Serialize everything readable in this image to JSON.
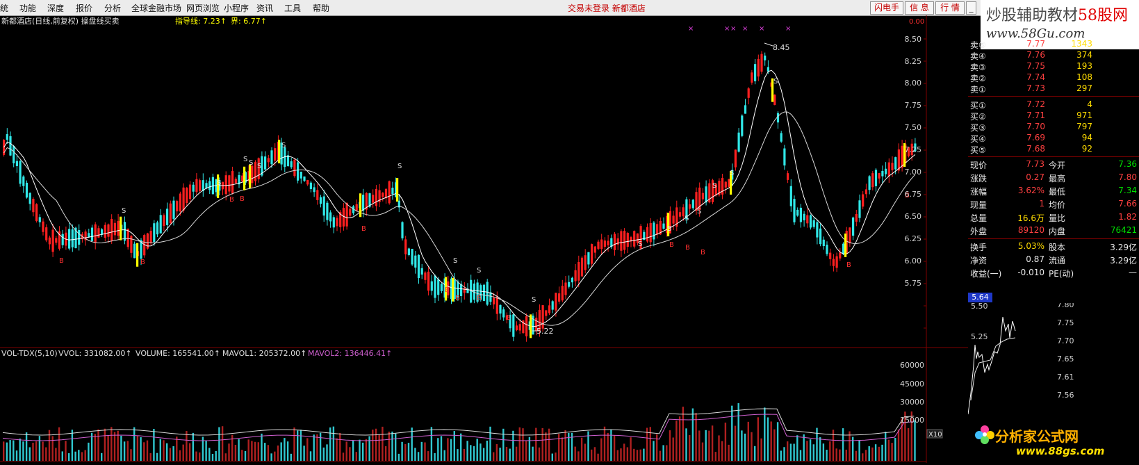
{
  "menubar": {
    "items": [
      "统",
      "功能",
      "深度",
      "报价",
      "分析",
      "全球金融市场",
      "网页浏览",
      "小程序",
      "资讯",
      "工具",
      "帮助"
    ],
    "center_text": "交易未登录 新都酒店",
    "buttons": [
      "闪电手",
      "信 息",
      "行 情"
    ],
    "window_controls": [
      "minimize-icon",
      "restore-icon",
      "close-icon"
    ]
  },
  "brand": {
    "text_a": "炒股辅助教材",
    "text_b": "58股网",
    "url": "www.58Gu.com"
  },
  "main_chart": {
    "title": "新都酒店(日线,前复权) 操盘线买卖",
    "indicator_a": "指导线: 7.23↑",
    "indicator_b": "界: 6.77↑",
    "high_label": "8.45",
    "low_label": "5.22",
    "badge": "0.00",
    "y_axis": [
      "8.50",
      "8.25",
      "8.00",
      "7.75",
      "7.50",
      "7.25",
      "7.00",
      "6.75",
      "6.50",
      "6.25",
      "6.00",
      "5.75",
      "5.50",
      "5.25"
    ],
    "signal_buy": "B",
    "signal_sell": "S",
    "mark": "×",
    "colors": {
      "up": "#ff2020",
      "down": "#30e8e8",
      "signal": "#ffff00",
      "ma1": "#ffffff",
      "ma2": "#d8d8d8",
      "grid": "#800000",
      "mavol2": "#d060d0"
    }
  },
  "volume_chart": {
    "label_name": "VOL-TDX(5,10)",
    "label_vvol": "VVOL: 331082.00↑",
    "label_volume": "VOLUME: 165541.00↑",
    "label_mavol1": "MAVOL1: 205372.00↑",
    "label_mavol2": "MAVOL2: 136446.41↑",
    "y_axis": [
      "60000",
      "45000",
      "30000",
      "15000"
    ],
    "multiplier": "X10"
  },
  "quote_panel": {
    "asks": [
      {
        "label": "卖⑤",
        "price": "7.77",
        "qty": "1343"
      },
      {
        "label": "卖④",
        "price": "7.76",
        "qty": "374"
      },
      {
        "label": "卖③",
        "price": "7.75",
        "qty": "193"
      },
      {
        "label": "卖②",
        "price": "7.74",
        "qty": "108"
      },
      {
        "label": "卖①",
        "price": "7.73",
        "qty": "297"
      }
    ],
    "bids": [
      {
        "label": "买①",
        "price": "7.72",
        "qty": "4"
      },
      {
        "label": "买②",
        "price": "7.71",
        "qty": "971"
      },
      {
        "label": "买③",
        "price": "7.70",
        "qty": "797"
      },
      {
        "label": "买④",
        "price": "7.69",
        "qty": "94"
      },
      {
        "label": "买⑤",
        "price": "7.68",
        "qty": "92"
      }
    ],
    "stats": [
      {
        "k1": "现价",
        "v1": "7.73",
        "c1": "red",
        "k2": "今开",
        "v2": "7.36",
        "c2": "green"
      },
      {
        "k1": "涨跌",
        "v1": "0.27",
        "c1": "red",
        "k2": "最高",
        "v2": "7.80",
        "c2": "red"
      },
      {
        "k1": "涨幅",
        "v1": "3.62%",
        "c1": "red",
        "k2": "最低",
        "v2": "7.34",
        "c2": "green"
      },
      {
        "k1": "现量",
        "v1": "1",
        "c1": "red",
        "k2": "均价",
        "v2": "7.66",
        "c2": "red"
      },
      {
        "k1": "总量",
        "v1": "16.6万",
        "c1": "yellow",
        "k2": "量比",
        "v2": "1.82",
        "c2": "red"
      },
      {
        "k1": "外盘",
        "v1": "89120",
        "c1": "red",
        "k2": "内盘",
        "v2": "76421",
        "c2": "green"
      }
    ],
    "stats2": [
      {
        "k1": "换手",
        "v1": "5.03%",
        "c1": "yellow",
        "k2": "股本",
        "v2": "3.29亿",
        "c2": "white"
      },
      {
        "k1": "净资",
        "v1": "0.87",
        "c1": "white",
        "k2": "流通",
        "v2": "3.29亿",
        "c2": "white"
      },
      {
        "k1": "收益(一)",
        "v1": "-0.010",
        "c1": "white",
        "k2": "PE(动)",
        "v2": "—",
        "c2": "white"
      }
    ]
  },
  "mini_chart": {
    "price_box": "5.64",
    "left_axis": [
      "5.50",
      "5.25"
    ],
    "right_axis": [
      "7.80",
      "7.75",
      "7.70",
      "7.65",
      "7.61",
      "7.56"
    ]
  },
  "logo": {
    "title": "分析家公式网",
    "url": "www.88gs.com"
  }
}
